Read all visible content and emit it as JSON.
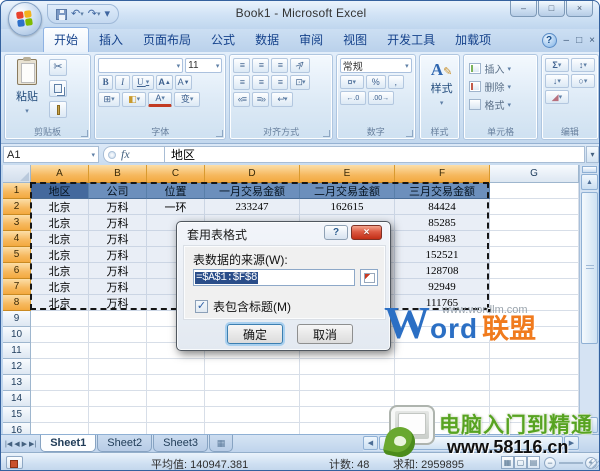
{
  "window": {
    "title": "Book1 - Microsoft Excel",
    "controls": {
      "minimize": "–",
      "restore": "□",
      "close": "×"
    },
    "workbook_controls": {
      "help": "?",
      "minimize": "–",
      "restore": "□",
      "close": "×"
    }
  },
  "qat": {
    "save_icon": "save",
    "undo": "↶",
    "redo": "↷",
    "more": "▾"
  },
  "ribbon_tabs": {
    "items": [
      "开始",
      "插入",
      "页面布局",
      "公式",
      "数据",
      "审阅",
      "视图",
      "开发工具",
      "加载项"
    ],
    "active": "开始"
  },
  "ribbon": {
    "clipboard": {
      "label": "剪贴板",
      "paste": "粘贴",
      "cut_icon": "✂",
      "dropdown": "▾"
    },
    "font": {
      "label": "字体",
      "size": "11",
      "bold": "B",
      "italic": "I",
      "underline": "U",
      "grow": "A",
      "shrink": "A",
      "borders": "⊞",
      "fill": "◧",
      "color": "A",
      "phonetic": "变"
    },
    "alignment": {
      "label": "对齐方式",
      "lines": "≡"
    },
    "number": {
      "label": "数字",
      "format": "常规",
      "currency": "¤",
      "percent": "%",
      "comma": ",",
      "inc_dec": "←.0",
      "dec_dec": ".00→"
    },
    "styles": {
      "label": "样式",
      "button": "样式",
      "icon": "A",
      "pencil": "✎"
    },
    "cells": {
      "label": "单元格",
      "insert": "插入",
      "delete": "删除",
      "format": "格式"
    },
    "editing": {
      "label": "编辑",
      "autosum": "Σ",
      "sort": "↕",
      "fill": "↓",
      "find": "○",
      "clear": "◢"
    }
  },
  "formula_bar": {
    "name_box": "A1",
    "fx": "fx",
    "content": "地区",
    "expand": "▾",
    "dropdown": "▾"
  },
  "sheet": {
    "col_headers": [
      "A",
      "B",
      "C",
      "D",
      "E",
      "F",
      "G"
    ],
    "selected_col_count": 6,
    "row_count": 16,
    "selected_row_count": 8,
    "selection_range": "A1:F8",
    "rows": [
      [
        "地区",
        "公司",
        "位置",
        "一月交易金额",
        "二月交易金额",
        "三月交易金额"
      ],
      [
        "北京",
        "万科",
        "一环",
        "233247",
        "162615",
        "84424"
      ],
      [
        "北京",
        "万科",
        "",
        "",
        "",
        "85285"
      ],
      [
        "北京",
        "万科",
        "",
        "",
        "",
        "84983"
      ],
      [
        "北京",
        "万科",
        "",
        "",
        "",
        "152521"
      ],
      [
        "北京",
        "万科",
        "",
        "",
        "",
        "128708"
      ],
      [
        "北京",
        "万科",
        "",
        "",
        "",
        "92949"
      ],
      [
        "北京",
        "万科",
        "",
        "",
        "",
        "111765"
      ]
    ]
  },
  "dialog": {
    "title": "套用表格式",
    "help": "?",
    "close": "×",
    "source_label": "表数据的来源(W):",
    "source_value": "=$A$1:$F$8",
    "checkbox_checked": true,
    "check_glyph": "✓",
    "checkbox_label": "表包含标题(M)",
    "ok": "确定",
    "cancel": "取消"
  },
  "sheet_tabs": {
    "nav": [
      "|◀",
      "◀",
      "▶",
      "▶|"
    ],
    "items": [
      "Sheet1",
      "Sheet2",
      "Sheet3"
    ],
    "active": "Sheet1",
    "insert_icon": "▦"
  },
  "status_bar": {
    "average": "平均值: 140947.381",
    "count": "计数: 48",
    "sum": "求和: 2959895",
    "zoom_out": "−",
    "zoom_in": "+"
  },
  "watermarks": {
    "wordlm": {
      "url": "www.wordlm.com",
      "brand_w": "W",
      "brand_rest": "ord",
      "brand_cjk": "联盟",
      "blue": "#2B6FC4",
      "orange": "#F07B1E"
    },
    "bottom_right": {
      "text": "电脑入门到精通",
      "url": "www.58116.cn",
      "green": "#57A321"
    }
  },
  "colors": {
    "selected_header": "#F3A940",
    "header_row_fill": "#6C8FBC",
    "active_cell_fill": "#44699D",
    "selection_fill": "#E9EEF6",
    "dialog_close_red": "#C22E16",
    "input_highlight": "#2A4D89"
  }
}
